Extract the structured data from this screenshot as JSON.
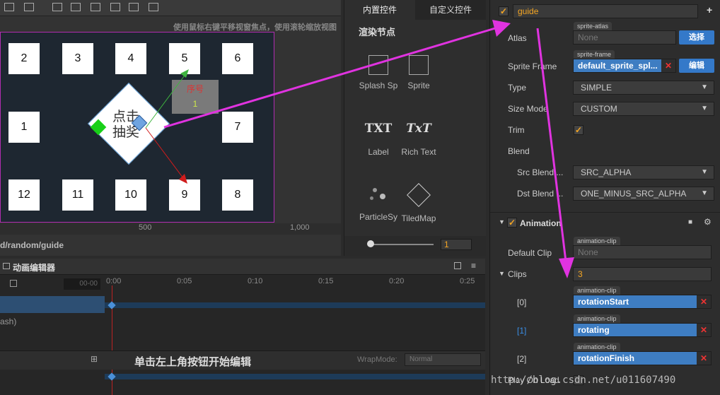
{
  "scene": {
    "hint": "使用鼠标右键平移视窗焦点，使用滚轮缩放视图",
    "tiles": [
      "2",
      "3",
      "4",
      "5",
      "6",
      "1",
      "7",
      "12",
      "11",
      "10",
      "9",
      "8"
    ],
    "button_text": "点击抽奖",
    "order_label": "序号",
    "order_value": "1",
    "ruler_500": "500",
    "ruler_1000": "1,000",
    "path": "d/random/guide"
  },
  "library": {
    "tab_builtin": "内置控件",
    "tab_custom": "自定义控件",
    "section": "渲染节点",
    "items": [
      "Splash Sp",
      "Sprite",
      "Label",
      "Rich Text",
      "ParticleSy",
      "TiledMap"
    ],
    "label_glyph": "TXT",
    "richtext_glyph": "TxT",
    "zoom_value": "1"
  },
  "inspector": {
    "node_name": "guide",
    "atlas_label": "Atlas",
    "atlas_tag": "sprite-atlas",
    "atlas_value": "None",
    "select_btn": "选择",
    "sprite_frame_label": "Sprite Frame",
    "sprite_frame_tag": "sprite-frame",
    "sprite_frame_value": "default_sprite_spl...",
    "edit_btn": "编辑",
    "type_label": "Type",
    "type_value": "SIMPLE",
    "size_mode_label": "Size Mode",
    "size_mode_value": "CUSTOM",
    "trim_label": "Trim",
    "blend_label": "Blend",
    "src_blend_label": "Src Blend ...",
    "src_blend_value": "SRC_ALPHA",
    "dst_blend_label": "Dst Blend ...",
    "dst_blend_value": "ONE_MINUS_SRC_ALPHA",
    "animation_title": "Animation",
    "default_clip_label": "Default Clip",
    "clip_tag": "animation-clip",
    "default_clip_value": "None",
    "clips_label": "Clips",
    "clips_count": "3",
    "clip_items": [
      {
        "index": "[0]",
        "value": "rotationStart"
      },
      {
        "index": "[1]",
        "value": "rotating"
      },
      {
        "index": "[2]",
        "value": "rotationFinish"
      }
    ],
    "play_on_load_label": "Play On Load"
  },
  "anim": {
    "title": "动画编辑器",
    "frame": "00-00",
    "ticks": [
      "0:00",
      "0:05",
      "0:10",
      "0:15",
      "0:20",
      "0:25"
    ],
    "track": "ash)",
    "message": "单击左上角按钮开始编辑",
    "wrap_label": "WrapMode:",
    "wrap_value": "Normal"
  },
  "watermark": "http://blog.csdn.net/u011607490",
  "colors": {
    "accent": "#f5a623",
    "magenta": "#e033e0",
    "blue": "#3e7dc2"
  }
}
